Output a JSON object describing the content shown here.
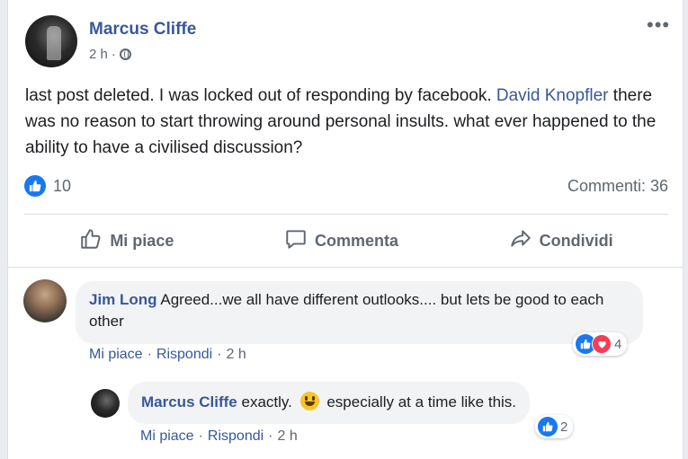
{
  "post": {
    "author": "Marcus Cliffe",
    "time": "2 h",
    "separator": "·",
    "more": "•••",
    "text_before": "last post deleted. I was locked out of responding by facebook. ",
    "mention": "David Knopfler",
    "text_after": " there was no reason to start throwing around personal insults. what ever happened to the ability to have a civilised discussion?",
    "reaction_count": "10",
    "comments_count": "Commenti: 36"
  },
  "actions": {
    "like": "Mi piace",
    "comment": "Commenta",
    "share": "Condividi"
  },
  "comments": [
    {
      "author": "Jim Long",
      "text": "Agreed...we all have different outlooks.... but lets be good to each other",
      "like_label": "Mi piace",
      "reply_label": "Rispondi",
      "separator": "·",
      "time": "2 h",
      "reaction_count": "4"
    },
    {
      "author": "Marcus Cliffe",
      "text_before": "exactly.",
      "text_after": "especially at a time like this.",
      "like_label": "Mi piace",
      "reply_label": "Rispondi",
      "separator": "·",
      "time": "2 h",
      "reaction_count": "2"
    }
  ],
  "colors": {
    "link": "#385898",
    "like_blue": "#1877f2",
    "heart_red": "#f33e58",
    "muted": "#606770"
  },
  "icons": [
    "globe-icon",
    "more-options-icon",
    "like-reaction-icon",
    "heart-reaction-icon",
    "thumbs-up-icon",
    "comment-icon",
    "share-icon",
    "smiley-emoji-icon"
  ]
}
